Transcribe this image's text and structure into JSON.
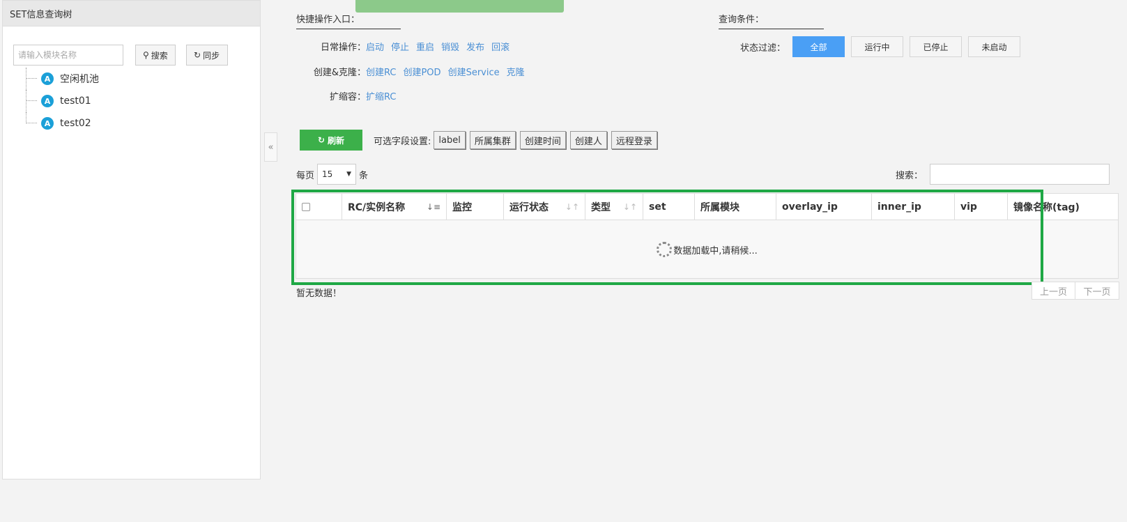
{
  "sidebar": {
    "title": "SET信息查询树",
    "search_placeholder": "请输入模块名称",
    "search_button": "搜索",
    "sync_button": "同步",
    "tree": [
      {
        "badge": "A",
        "label": "空闲机池"
      },
      {
        "badge": "A",
        "label": "test01"
      },
      {
        "badge": "A",
        "label": "test02"
      }
    ],
    "collapse_glyph": "«"
  },
  "quick_ops": {
    "title": "快捷操作入口：",
    "rows": [
      {
        "label": "日常操作：",
        "links": [
          "启动",
          "停止",
          "重启",
          "销毁",
          "发布",
          "回滚"
        ]
      },
      {
        "label": "创建&克隆：",
        "links": [
          "创建RC",
          "创建POD",
          "创建Service",
          "克隆"
        ]
      },
      {
        "label": "扩缩容：",
        "links": [
          "扩缩RC"
        ]
      }
    ]
  },
  "query": {
    "title": "查询条件：",
    "filter_label": "状态过滤：",
    "filters": [
      "全部",
      "运行中",
      "已停止",
      "未启动"
    ],
    "active_filter": "全部"
  },
  "toolbar": {
    "refresh_label": "刷新",
    "fields_label": "可选字段设置:",
    "fields": [
      "label",
      "所属集群",
      "创建时间",
      "创建人",
      "远程登录"
    ]
  },
  "pagination": {
    "per_page_label": "每页",
    "per_page_value": "15",
    "per_page_unit": "条",
    "search_label": "搜索：",
    "no_data": "暂无数据！",
    "prev": "上一页",
    "next": "下一页"
  },
  "table": {
    "columns": [
      {
        "label": "",
        "sort": "none"
      },
      {
        "label": "RC/实例名称",
        "sort": "active"
      },
      {
        "label": "监控",
        "sort": "none"
      },
      {
        "label": "运行状态",
        "sort": "both"
      },
      {
        "label": "类型",
        "sort": "both"
      },
      {
        "label": "set",
        "sort": "none"
      },
      {
        "label": "所属模块",
        "sort": "none"
      },
      {
        "label": "overlay_ip",
        "sort": "none"
      },
      {
        "label": "inner_ip",
        "sort": "none"
      },
      {
        "label": "vip",
        "sort": "none"
      },
      {
        "label": "镜像名称(tag)",
        "sort": "none"
      }
    ],
    "loading_text": "数据加载中,请稍候..."
  },
  "colors": {
    "primary": "#4a9ff5",
    "success": "#3cb04a",
    "link": "#4a8fd4",
    "highlight": "#1fa845",
    "tree_badge": "#1ba0d8"
  }
}
